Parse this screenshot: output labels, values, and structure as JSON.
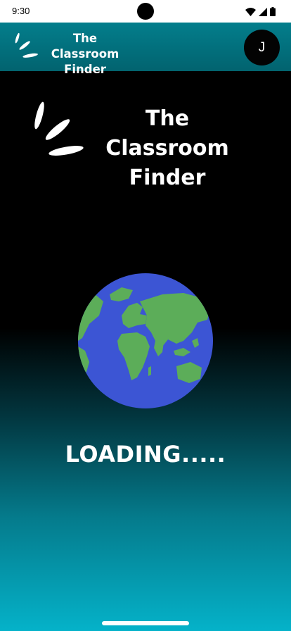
{
  "status_bar": {
    "time": "9:30",
    "icons": [
      "wifi-icon",
      "signal-icon",
      "battery-icon"
    ]
  },
  "app_bar": {
    "title": "The Classroom\nFinder",
    "avatar_initial": "J",
    "background_color": "#037e8c",
    "logo_icon": "speed-lines-logo-icon"
  },
  "brand": {
    "title": "The Classroom\nFinder",
    "logo_icon": "speed-lines-logo-icon"
  },
  "main": {
    "globe_icon": "globe-icon",
    "loading_text": "LOADING....."
  },
  "colors": {
    "gradient_top": "#000000",
    "gradient_bottom": "#05b2c9",
    "globe_ocean": "#3c55d4",
    "globe_land": "#5cad59"
  }
}
